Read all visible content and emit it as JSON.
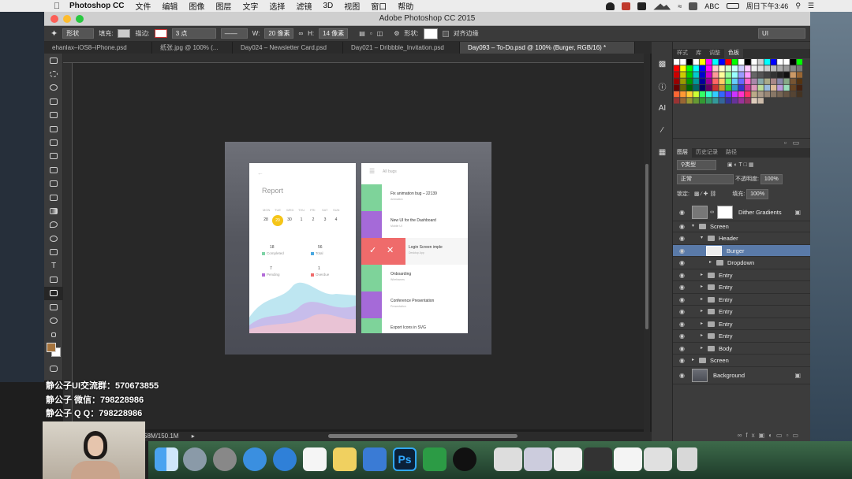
{
  "menubar": {
    "app_name": "Photoshop CC",
    "menus": [
      "文件",
      "编辑",
      "图像",
      "图层",
      "文字",
      "选择",
      "滤镜",
      "3D",
      "视图",
      "窗口",
      "帮助"
    ],
    "input_label": "ABC",
    "clock": "周日下午3:46"
  },
  "window": {
    "title": "Adobe Photoshop CC 2015"
  },
  "options_bar": {
    "shape_mode": "形状",
    "fill_label": "填充:",
    "stroke_label": "描边:",
    "stroke_width": "3 点",
    "w_label": "W:",
    "w_value": "20 像素",
    "h_label": "H:",
    "h_value": "14 像素",
    "shape_label": "形状:",
    "align_edges_label": "对齐边缘",
    "workspace": "UI"
  },
  "tabs": [
    {
      "label": "ehanlax–iOS8–iPhone.psd",
      "active": false
    },
    {
      "label": "纸张.jpg @ 100% (...",
      "active": false
    },
    {
      "label": "Day024 – Newsletter Card.psd",
      "active": false
    },
    {
      "label": "Day021 – Dribbble_Invitation.psd",
      "active": false
    },
    {
      "label": "Day093 – To-Do.psd @ 100% (Burger, RGB/16) *",
      "active": true
    }
  ],
  "statusbar": {
    "doc_size": "58M/150.1M"
  },
  "report_card": {
    "title": "Report",
    "days": [
      "MON",
      "TUE",
      "WED",
      "THU",
      "FRI",
      "SAT",
      "SUN"
    ],
    "dates": [
      "28",
      "29",
      "30",
      "1",
      "2",
      "3",
      "4"
    ],
    "stats": [
      {
        "value": "18",
        "label": "Completed",
        "color": "#7ed3a6"
      },
      {
        "value": "56",
        "label": "Total",
        "color": "#4aa8e0"
      },
      {
        "value": "7",
        "label": "Pending",
        "color": "#b26bd8"
      },
      {
        "value": "1",
        "label": "Overdue",
        "color": "#ef6b6b"
      }
    ]
  },
  "todo_card": {
    "header": "All bugs",
    "items": [
      {
        "title": "Fix animation bug – 22139",
        "sub": "Animation",
        "color": "#7ed39a"
      },
      {
        "title": "New UI for the Dashboard",
        "sub": "Mobile UI",
        "color": "#a56ad8"
      },
      {
        "title": "Login Screen imple",
        "sub": "Desktop App",
        "color": "#ef6b6b"
      },
      {
        "title": "Onboarding",
        "sub": "Wireframes",
        "color": "#7ed39a"
      },
      {
        "title": "Conference Presentation",
        "sub": "Presentation",
        "color": "#a56ad8"
      },
      {
        "title": "Export Icons in SVG",
        "sub": "",
        "color": "#7ed39a"
      }
    ]
  },
  "swatches_panel": {
    "tabs": [
      "样式",
      "库",
      "调整",
      "色板"
    ],
    "active": "色板"
  },
  "layers_panel": {
    "tabs": [
      "图层",
      "历史记录",
      "路径"
    ],
    "filter_kind": "类型",
    "blend_mode": "正常",
    "opacity_label": "不透明度:",
    "opacity": "100%",
    "lock_label": "锁定:",
    "fill_label": "填充:",
    "fill": "100%",
    "layers": [
      {
        "name": "Dither Gradients",
        "indent": 0,
        "type": "smart",
        "selected": false
      },
      {
        "name": "Screen",
        "indent": 0,
        "type": "group-open",
        "selected": false
      },
      {
        "name": "Header",
        "indent": 1,
        "type": "group-open",
        "selected": false
      },
      {
        "name": "Burger",
        "indent": 2,
        "type": "shape",
        "selected": true
      },
      {
        "name": "Dropdown",
        "indent": 2,
        "type": "group",
        "selected": false
      },
      {
        "name": "Entry",
        "indent": 1,
        "type": "group",
        "selected": false
      },
      {
        "name": "Entry",
        "indent": 1,
        "type": "group",
        "selected": false
      },
      {
        "name": "Entry",
        "indent": 1,
        "type": "group",
        "selected": false
      },
      {
        "name": "Entry",
        "indent": 1,
        "type": "group",
        "selected": false
      },
      {
        "name": "Entry",
        "indent": 1,
        "type": "group",
        "selected": false
      },
      {
        "name": "Entry",
        "indent": 1,
        "type": "group",
        "selected": false
      },
      {
        "name": "Body",
        "indent": 1,
        "type": "group",
        "selected": false
      },
      {
        "name": "Screen",
        "indent": 0,
        "type": "group",
        "selected": false
      },
      {
        "name": "Background",
        "indent": 0,
        "type": "image",
        "selected": false
      }
    ]
  },
  "overlay": {
    "line1": "静公子UI交流群：570673855",
    "line2": "静公子      微信：798228986",
    "line3": "静公子      Q Q：798228986"
  }
}
